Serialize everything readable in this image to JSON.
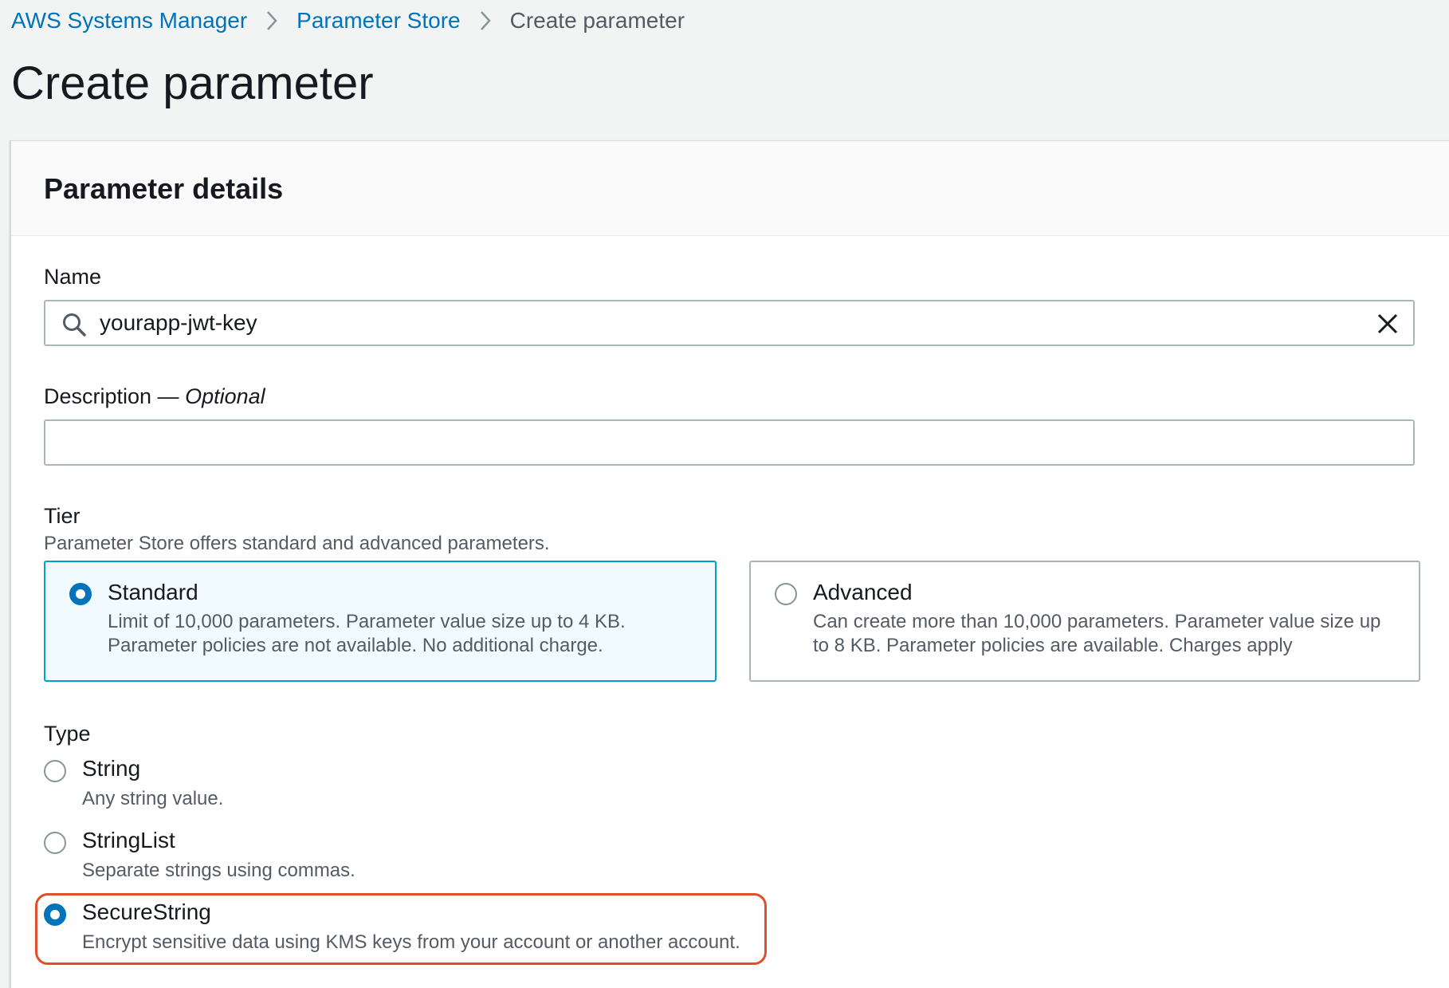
{
  "breadcrumb": {
    "items": [
      "AWS Systems Manager",
      "Parameter Store",
      "Create parameter"
    ]
  },
  "page": {
    "title": "Create parameter"
  },
  "panel": {
    "title": "Parameter details"
  },
  "name_field": {
    "label": "Name",
    "value": "yourapp-jwt-key",
    "icon": "search-icon",
    "clear_icon": "close-icon"
  },
  "description_field": {
    "label": "Description —",
    "optional": "Optional",
    "value": ""
  },
  "tier": {
    "label": "Tier",
    "hint": "Parameter Store offers standard and advanced parameters.",
    "selected": "Standard",
    "options": [
      {
        "title": "Standard",
        "desc_line1": "Limit of 10,000 parameters. Parameter value size up to 4 KB.",
        "desc_line2": "Parameter policies are not available. No additional charge."
      },
      {
        "title": "Advanced",
        "desc_line1": "Can create more than 10,000 parameters. Parameter value size up",
        "desc_line2": "to 8 KB. Parameter policies are available. Charges apply"
      }
    ]
  },
  "type": {
    "label": "Type",
    "selected": "SecureString",
    "options": [
      {
        "title": "String",
        "desc": "Any string value."
      },
      {
        "title": "StringList",
        "desc": "Separate strings using commas."
      },
      {
        "title": "SecureString",
        "desc": "Encrypt sensitive data using KMS keys from your account or another account."
      }
    ]
  },
  "colors": {
    "link": "#0073bb",
    "radio_selected": "#0073bb",
    "tile_selected_border": "#00a1c9",
    "tile_selected_bg": "#f1faff",
    "highlight": "#e04e2c",
    "page_bg": "#f2f3f3"
  }
}
